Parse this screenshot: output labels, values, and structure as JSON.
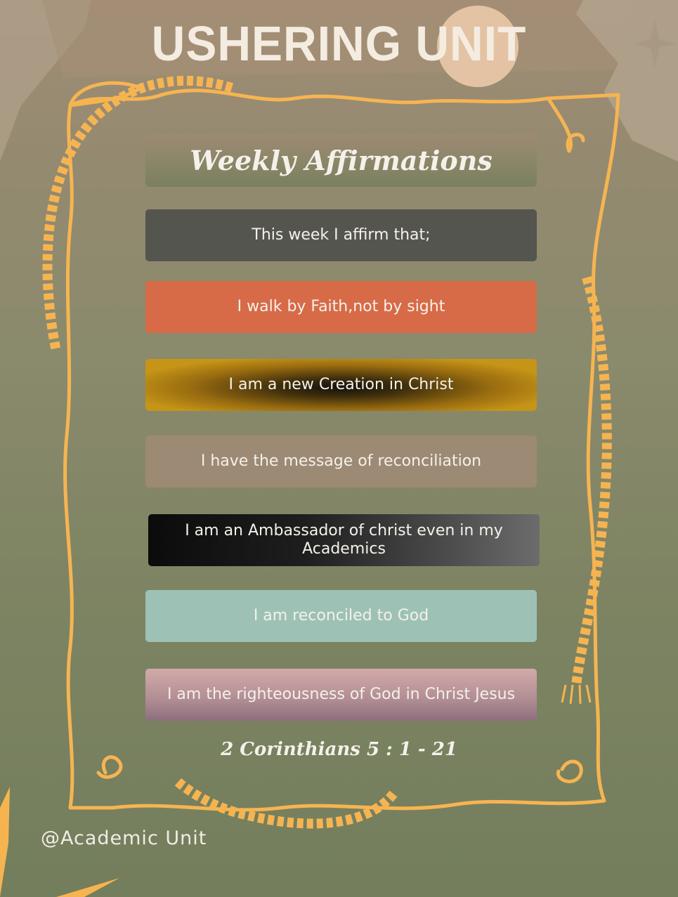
{
  "title": "USHERING UNIT",
  "heading": "Weekly Affirmations",
  "affirmations": [
    "This week I affirm that;",
    "I walk by Faith,not by sight",
    "I am a new Creation in Christ",
    "I have the message of reconciliation",
    "I am an Ambassador of christ even in my Academics",
    "I am reconciled to God",
    "I am the righteousness of God in Christ Jesus"
  ],
  "scripture": "2 Corinthians  5 : 1 - 21",
  "footer": "@Academic  Unit",
  "colors": {
    "frame": "#f6b451",
    "title": "#f4ece0",
    "panel_orange": "#d76b47",
    "panel_teal": "#9dc2b5",
    "panel_gold": "#c69517"
  },
  "icons": [
    "sparkle-icon",
    "scroll-frame-icon",
    "rope-icon"
  ]
}
